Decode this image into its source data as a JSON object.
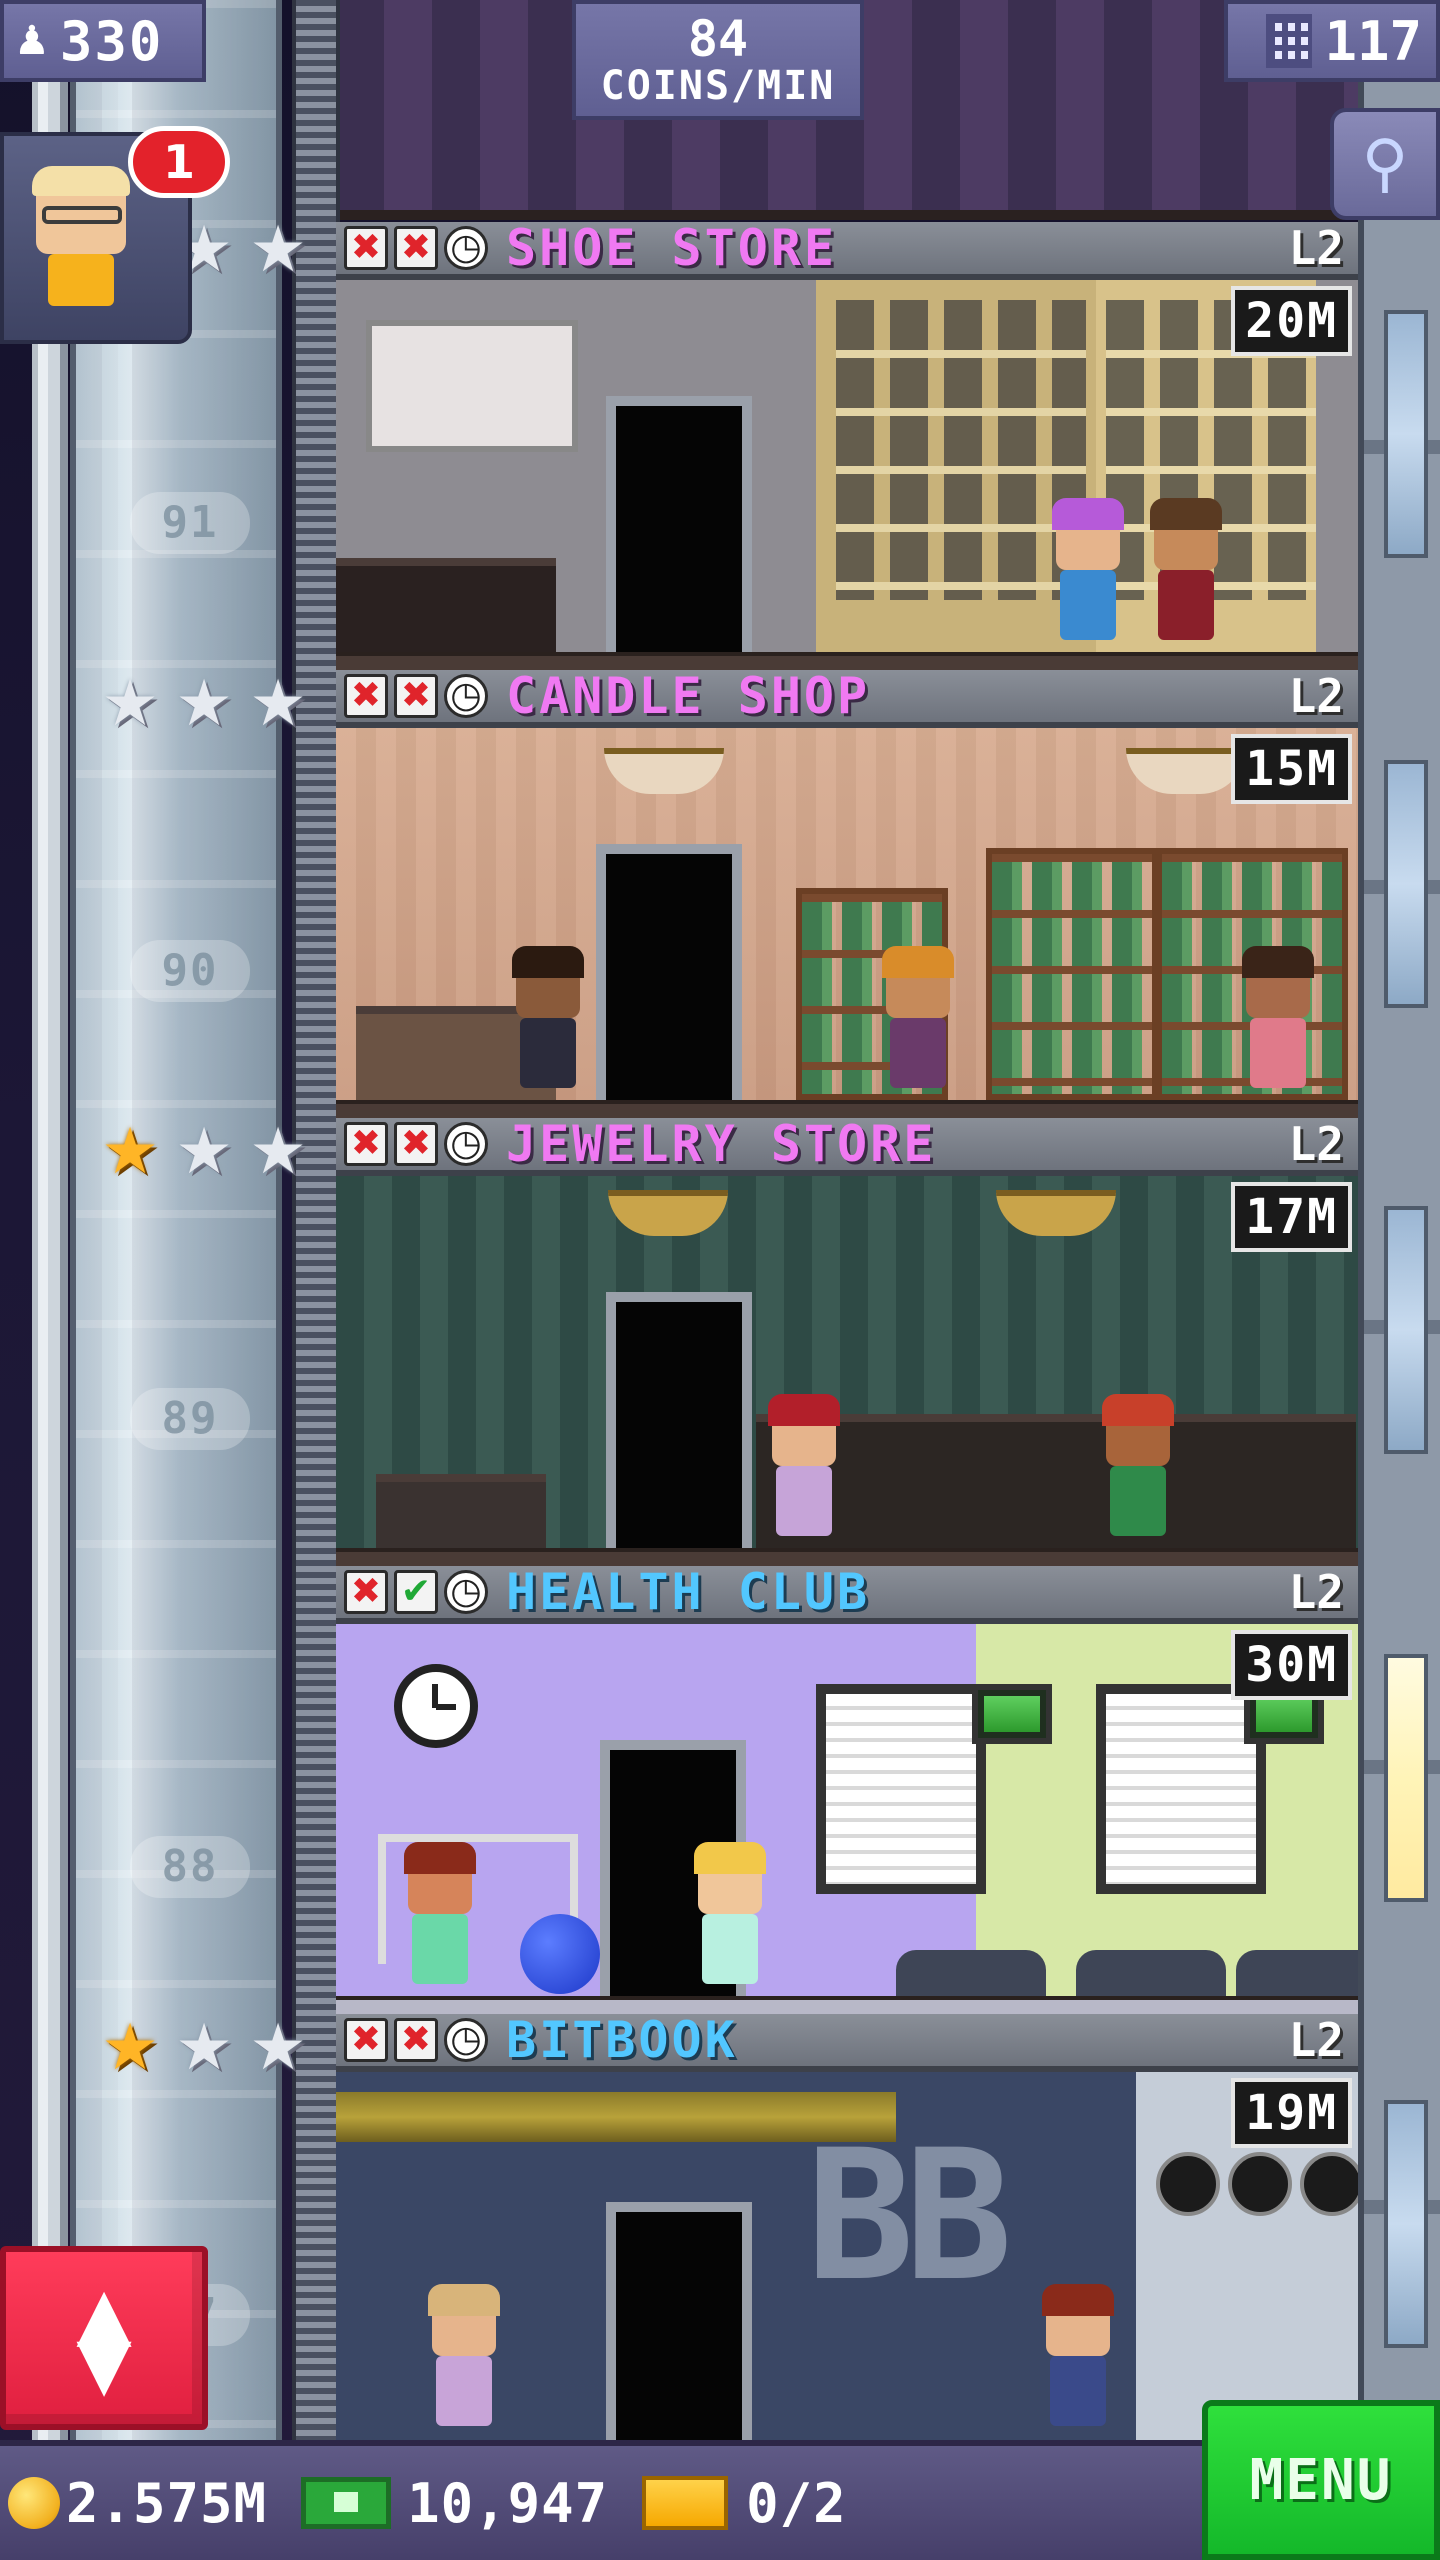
{
  "hud": {
    "population": "330",
    "coins_per_min_value": "84",
    "coins_per_min_unit": "COINS/MIN",
    "floor_count": "117",
    "notification_count": "1",
    "population_icon": "person-icon",
    "floors_icon": "building-icon",
    "search_icon": "magnifier-icon"
  },
  "shaft": {
    "floor_numbers": [
      "91",
      "90",
      "89",
      "88",
      "87"
    ]
  },
  "floors": [
    {
      "name": "SHOE STORE",
      "level": "L2",
      "cost": "20M",
      "stock_status": [
        "x",
        "x",
        "clock"
      ],
      "stars": [
        "silver",
        "silver",
        "silver"
      ],
      "name_color": "#f079f2"
    },
    {
      "name": "CANDLE SHOP",
      "level": "L2",
      "cost": "15M",
      "stock_status": [
        "x",
        "x",
        "clock"
      ],
      "stars": [
        "silver",
        "silver",
        "silver"
      ],
      "name_color": "#f079f2"
    },
    {
      "name": "JEWELRY STORE",
      "level": "L2",
      "cost": "17M",
      "stock_status": [
        "x",
        "x",
        "clock"
      ],
      "stars": [
        "gold",
        "silver",
        "silver"
      ],
      "name_color": "#f079f2"
    },
    {
      "name": "HEALTH CLUB",
      "level": "L2",
      "cost": "30M",
      "stock_status": [
        "x",
        "check",
        "clock"
      ],
      "stars": [],
      "name_color": "#52c7ff"
    },
    {
      "name": "BITBOOK",
      "level": "L2",
      "cost": "19M",
      "stock_status": [
        "x",
        "x",
        "clock"
      ],
      "stars": [
        "gold",
        "silver",
        "silver"
      ],
      "name_color": "#52c7ff"
    }
  ],
  "bottom_bar": {
    "coins": "2.575M",
    "bux": "10,947",
    "tickets": "0/2",
    "menu_label": "MENU"
  },
  "colors": {
    "accent_green": "#14b82a",
    "elevator_red": "#e01f3f",
    "hud_purple": "#5f5f92",
    "badge_red": "#e3222b"
  }
}
